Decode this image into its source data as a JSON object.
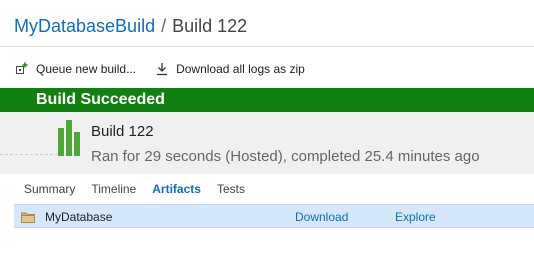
{
  "breadcrumb": {
    "definition": "MyDatabaseBuild",
    "separator": "/",
    "current": "Build 122"
  },
  "toolbar": {
    "queue_label": "Queue new build...",
    "download_logs_label": "Download all logs as zip"
  },
  "status": {
    "label": "Build Succeeded",
    "color": "#118011"
  },
  "build": {
    "title": "Build 122",
    "description": "Ran for 29 seconds (Hosted), completed 25.4 minutes ago"
  },
  "tabs": [
    {
      "label": "Summary",
      "active": false
    },
    {
      "label": "Timeline",
      "active": false
    },
    {
      "label": "Artifacts",
      "active": true
    },
    {
      "label": "Tests",
      "active": false
    }
  ],
  "artifacts": [
    {
      "name": "MyDatabase",
      "download_label": "Download",
      "explore_label": "Explore",
      "icon": "folder-icon"
    }
  ],
  "colors": {
    "accent": "#106ebe",
    "success": "#118011",
    "bars": "#4fa834",
    "row_selected": "#d5e7f9"
  }
}
